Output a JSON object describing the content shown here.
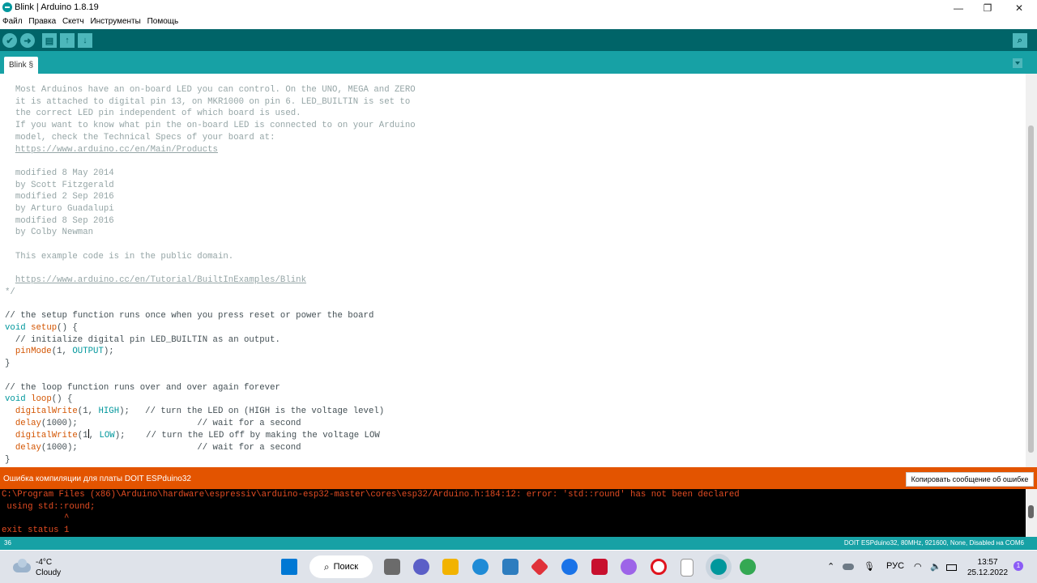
{
  "window": {
    "title": "Blink | Arduino 1.8.19",
    "minimize": "—",
    "maximize": "❐",
    "close": "✕"
  },
  "menu": [
    "Файл",
    "Правка",
    "Скетч",
    "Инструменты",
    "Помощь"
  ],
  "toolbar": {
    "verify_icon": "✔",
    "upload_icon": "➜",
    "new_icon": "▤",
    "open_icon": "↑",
    "save_icon": "↓",
    "serial_monitor_icon": "⌕"
  },
  "tab": {
    "label": "Blink §"
  },
  "editor": {
    "comment_lines": [
      "  Most Arduinos have an on-board LED you can control. On the UNO, MEGA and ZERO",
      "  it is attached to digital pin 13, on MKR1000 on pin 6. LED_BUILTIN is set to",
      "  the correct LED pin independent of which board is used.",
      "  If you want to know what pin the on-board LED is connected to on your Arduino",
      "  model, check the Technical Specs of your board at:",
      "",
      "",
      "  modified 8 May 2014",
      "  by Scott Fitzgerald",
      "  modified 2 Sep 2016",
      "  by Arturo Guadalupi",
      "  modified 8 Sep 2016",
      "  by Colby Newman",
      "",
      "  This example code is in the public domain.",
      "",
      "",
      "*/"
    ],
    "link_products": "https://www.arduino.cc/en/Main/Products",
    "link_tutorial": "https://www.arduino.cc/en/Tutorial/BuiltInExamples/Blink",
    "setup_comment": "// the setup function runs once when you press reset or power the board",
    "kw_void": "void",
    "fn_setup": "setup",
    "setup_paren": "() {",
    "init_comment": "  // initialize digital pin LED_BUILTIN as an output.",
    "fn_pinMode": "pinMode",
    "pinmode_args": "(1, ",
    "kw_output": "OUTPUT",
    "end_stmt": ");",
    "brace_close": "}",
    "loop_comment": "// the loop function runs over and over again forever",
    "fn_loop": "loop",
    "loop_paren": "() {",
    "fn_digitalWrite": "digitalWrite",
    "dw_args_open": "(1, ",
    "kw_high": "HIGH",
    "dw_high_tail": ");   // turn the LED on (HIGH is the voltage level)",
    "fn_delay": "delay",
    "delay_tail": "(1000);                       // wait for a second",
    "dw_args_open_caret1": "(1",
    "dw_args_open_caret2": ", ",
    "kw_low": "LOW",
    "dw_low_tail": ");    // turn the LED off by making the voltage LOW"
  },
  "status": {
    "message": "Ошибка компиляции для платы DOIT ESPduino32",
    "copy_button": "Копировать сообщение об ошибке"
  },
  "console": {
    "lines": [
      "C:\\Program Files (x86)\\Arduino\\hardware\\espressiv\\arduino-esp32-master\\cores\\esp32/Arduino.h:184:12: error: 'std::round' has not been declared",
      " using std::round;",
      "            ^",
      "exit status 1"
    ]
  },
  "bottom": {
    "line_number": "36",
    "board_info": "DOIT ESPduino32, 80MHz, 921600, None, Disabled на COM6"
  },
  "taskbar": {
    "temperature": "-4°C",
    "weather": "Cloudy",
    "search_label": "Поиск",
    "language": "РУС",
    "time": "13:57",
    "date": "25.12.2022",
    "notification_count": "1"
  },
  "colors": {
    "arduino_teal": "#00979c",
    "error_orange": "#e35400",
    "toolbar_dark": "#006468"
  }
}
